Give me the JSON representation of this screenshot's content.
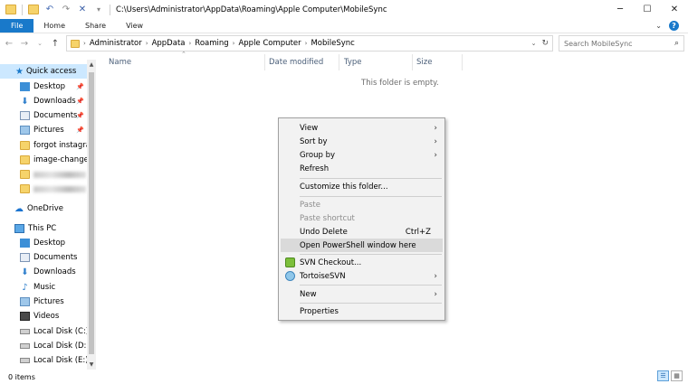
{
  "window": {
    "title": "C:\\Users\\Administrator\\AppData\\Roaming\\Apple Computer\\MobileSync",
    "controls": [
      "minimize-icon",
      "maximize-icon",
      "close-icon"
    ]
  },
  "ribbon": {
    "tabs": [
      "File",
      "Home",
      "Share",
      "View"
    ]
  },
  "address": {
    "breadcrumbs": [
      "Administrator",
      "AppData",
      "Roaming",
      "Apple Computer",
      "MobileSync"
    ],
    "search_placeholder": "Search MobileSync"
  },
  "nav": {
    "quick_access": "Quick access",
    "quick_items": [
      {
        "label": "Desktop",
        "pinned": true
      },
      {
        "label": "Downloads",
        "pinned": true
      },
      {
        "label": "Documents",
        "pinned": true
      },
      {
        "label": "Pictures",
        "pinned": true
      },
      {
        "label": "forgot instagram",
        "pinned": false
      },
      {
        "label": "image-change it",
        "pinned": false
      }
    ],
    "onedrive": "OneDrive",
    "this_pc": "This PC",
    "pc_items": [
      "Desktop",
      "Documents",
      "Downloads",
      "Music",
      "Pictures",
      "Videos",
      "Local Disk (C:)",
      "Local Disk (D:)",
      "Local Disk (E:)"
    ]
  },
  "columns": [
    "Name",
    "Date modified",
    "Type",
    "Size"
  ],
  "empty_message": "This folder is empty.",
  "context_menu": {
    "view": "View",
    "sort_by": "Sort by",
    "group_by": "Group by",
    "refresh": "Refresh",
    "customize": "Customize this folder...",
    "paste": "Paste",
    "paste_shortcut": "Paste shortcut",
    "undo_delete": "Undo Delete",
    "undo_shortcut": "Ctrl+Z",
    "powershell": "Open PowerShell window here",
    "svn_checkout": "SVN Checkout...",
    "tortoise": "TortoiseSVN",
    "new": "New",
    "properties": "Properties"
  },
  "status": {
    "items": "0 items"
  },
  "colors": {
    "accent": "#1979ca",
    "selection": "#cce8ff",
    "folder": "#f6d36a"
  }
}
